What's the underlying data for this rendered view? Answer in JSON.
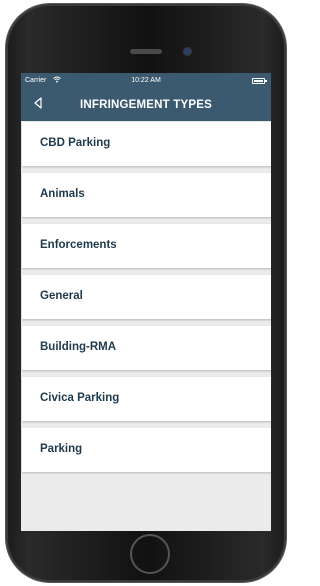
{
  "status_bar": {
    "carrier": "Carrier",
    "time": "10:22 AM"
  },
  "nav": {
    "back_icon": "back-chevron-icon",
    "title": "INFRINGEMENT TYPES"
  },
  "items": [
    {
      "label": "CBD Parking"
    },
    {
      "label": "Animals"
    },
    {
      "label": "Enforcements"
    },
    {
      "label": "General"
    },
    {
      "label": "Building-RMA"
    },
    {
      "label": "Civica Parking"
    },
    {
      "label": "Parking"
    }
  ],
  "colors": {
    "nav_bg": "#3b5a70",
    "list_bg": "#ebebeb",
    "item_text": "#1f3a4d"
  }
}
